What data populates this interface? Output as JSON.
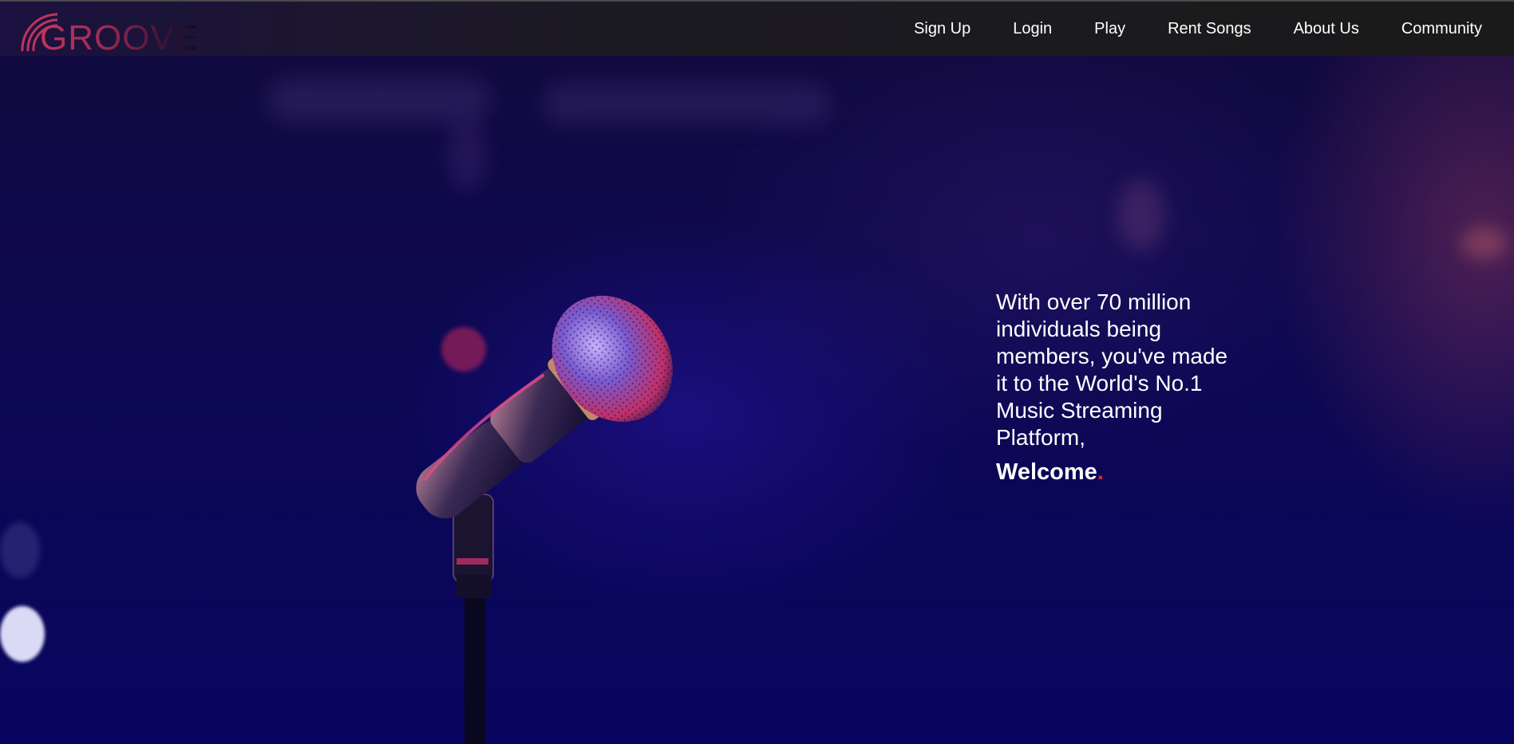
{
  "brand": {
    "logo_text": "GROOVE",
    "logo_icon": "sound-waves-icon"
  },
  "navbar": {
    "items": [
      {
        "label": "Sign Up"
      },
      {
        "label": "Login"
      },
      {
        "label": "Play"
      },
      {
        "label": "Rent Songs"
      },
      {
        "label": "About Us"
      },
      {
        "label": "Community"
      }
    ]
  },
  "hero": {
    "paragraph": "With over 70 million individuals being members, you've made it to the World's No.1 Music Streaming Platform,",
    "welcome": "Welcome",
    "welcome_punct": ".",
    "image_subject": "microphone-on-stand"
  },
  "colors": {
    "accent": "#e0262e",
    "navbar_bg": "#1a1a1a",
    "hero_bg": "#0a0650",
    "text": "#ffffff"
  }
}
